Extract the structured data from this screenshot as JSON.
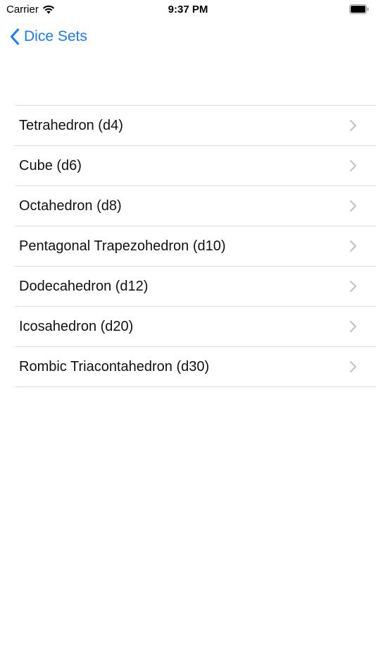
{
  "status_bar": {
    "carrier": "Carrier",
    "time": "9:37 PM",
    "wifi_icon": "wifi-icon",
    "battery_icon": "battery-icon"
  },
  "nav": {
    "back_label": "Dice Sets",
    "back_icon": "chevron-left-icon",
    "accent_color": "#1a7cf5"
  },
  "list": {
    "items": [
      {
        "label": "Tetrahedron (d4)"
      },
      {
        "label": "Cube (d6)"
      },
      {
        "label": "Octahedron (d8)"
      },
      {
        "label": "Pentagonal Trapezohedron (d10)"
      },
      {
        "label": "Dodecahedron (d12)"
      },
      {
        "label": "Icosahedron (d20)"
      },
      {
        "label": "Rombic Triacontahedron (d30)"
      }
    ],
    "disclosure_icon": "chevron-right-icon",
    "separator_color": "#dcdce0"
  }
}
